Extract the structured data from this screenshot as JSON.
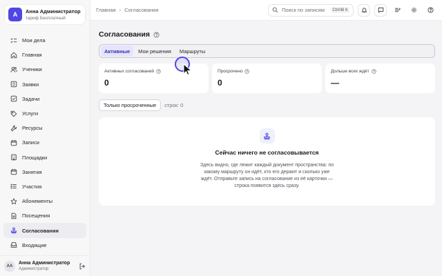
{
  "org": {
    "initial": "А",
    "name": "Анна Администратор",
    "plan": "тариф Бесплатный"
  },
  "nav": {
    "items": [
      {
        "label": "Мои дела",
        "icon": "checklist-icon"
      },
      {
        "label": "Главная",
        "icon": "home-icon"
      },
      {
        "label": "Ученики",
        "icon": "users-icon"
      },
      {
        "label": "Заявки",
        "icon": "list-icon"
      },
      {
        "label": "Задачи",
        "icon": "tasks-icon"
      },
      {
        "label": "Услуги",
        "icon": "tag-icon"
      },
      {
        "label": "Ресурсы",
        "icon": "tool-icon"
      },
      {
        "label": "Записи",
        "icon": "calendar-icon"
      },
      {
        "label": "Площадки",
        "icon": "building-icon"
      },
      {
        "label": "Занятия",
        "icon": "calendar-icon"
      },
      {
        "label": "Участия",
        "icon": "list-icon"
      },
      {
        "label": "Абонементы",
        "icon": "star-icon"
      },
      {
        "label": "Посещения",
        "icon": "document-icon"
      },
      {
        "label": "Согласования",
        "icon": "stamp-icon",
        "active": true
      },
      {
        "label": "Входящие",
        "icon": "inbox-icon"
      }
    ]
  },
  "user": {
    "initials": "АА",
    "name": "Анна Администратор",
    "role": "Администратор"
  },
  "breadcrumb": {
    "home": "Главная",
    "current": "Согласования"
  },
  "search": {
    "placeholder": "Поиск по записям",
    "shortcut": "Ctrl/⌘ K"
  },
  "page": {
    "title": "Согласования"
  },
  "tabs": [
    {
      "label": "Активные",
      "active": true
    },
    {
      "label": "Мои решения",
      "active": false
    },
    {
      "label": "Маршруты",
      "active": false
    }
  ],
  "stats": [
    {
      "label": "Активных согласований",
      "value": "0"
    },
    {
      "label": "Просрочено",
      "value": "0"
    },
    {
      "label": "Дольше всех ждёт",
      "value": "—"
    }
  ],
  "filter": {
    "button_label": "Только просроченные",
    "rows_count": "строк: 0"
  },
  "empty": {
    "title": "Сейчас ничего не согласовывается",
    "text": "Здесь видно, где лежит каждый документ пространства: по какому маршруту он идёт, кто его держит и сколько уже ждёт. Отправьте запись на согласование из её карточки — строка появится здесь сразу."
  },
  "colors": {
    "accent": "#4f46e5",
    "active_tab_bg": "#e4e4ff",
    "background": "#f4f4f6"
  }
}
